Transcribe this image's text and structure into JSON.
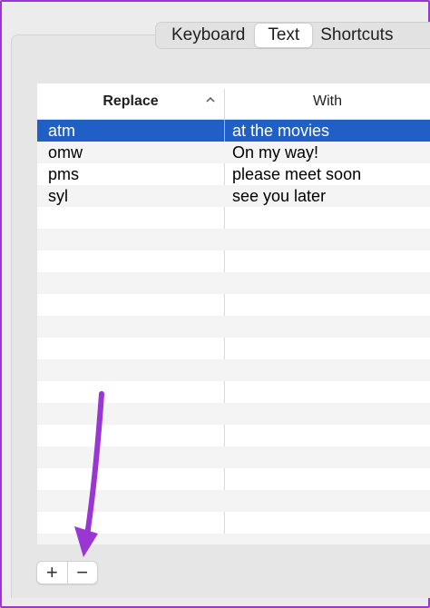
{
  "tabs": [
    {
      "label": "Keyboard",
      "active": false
    },
    {
      "label": "Text",
      "active": true
    },
    {
      "label": "Shortcuts",
      "active": false
    }
  ],
  "table": {
    "columns": {
      "replace": "Replace",
      "with": "With"
    },
    "sort": "ascending",
    "rows": [
      {
        "replace": "atm",
        "with": "at the movies",
        "selected": true
      },
      {
        "replace": "omw",
        "with": "On my way!",
        "selected": false
      },
      {
        "replace": "pms",
        "with": "please meet soon",
        "selected": false
      },
      {
        "replace": "syl",
        "with": "see you later",
        "selected": false
      }
    ]
  },
  "controls": {
    "add_label": "+",
    "remove_label": "−"
  },
  "colors": {
    "selection": "#1f5fc6",
    "annotation_arrow": "#9a37d3"
  },
  "icons": {
    "sort": "chevron-up-icon",
    "arrow": "annotation-arrow"
  }
}
